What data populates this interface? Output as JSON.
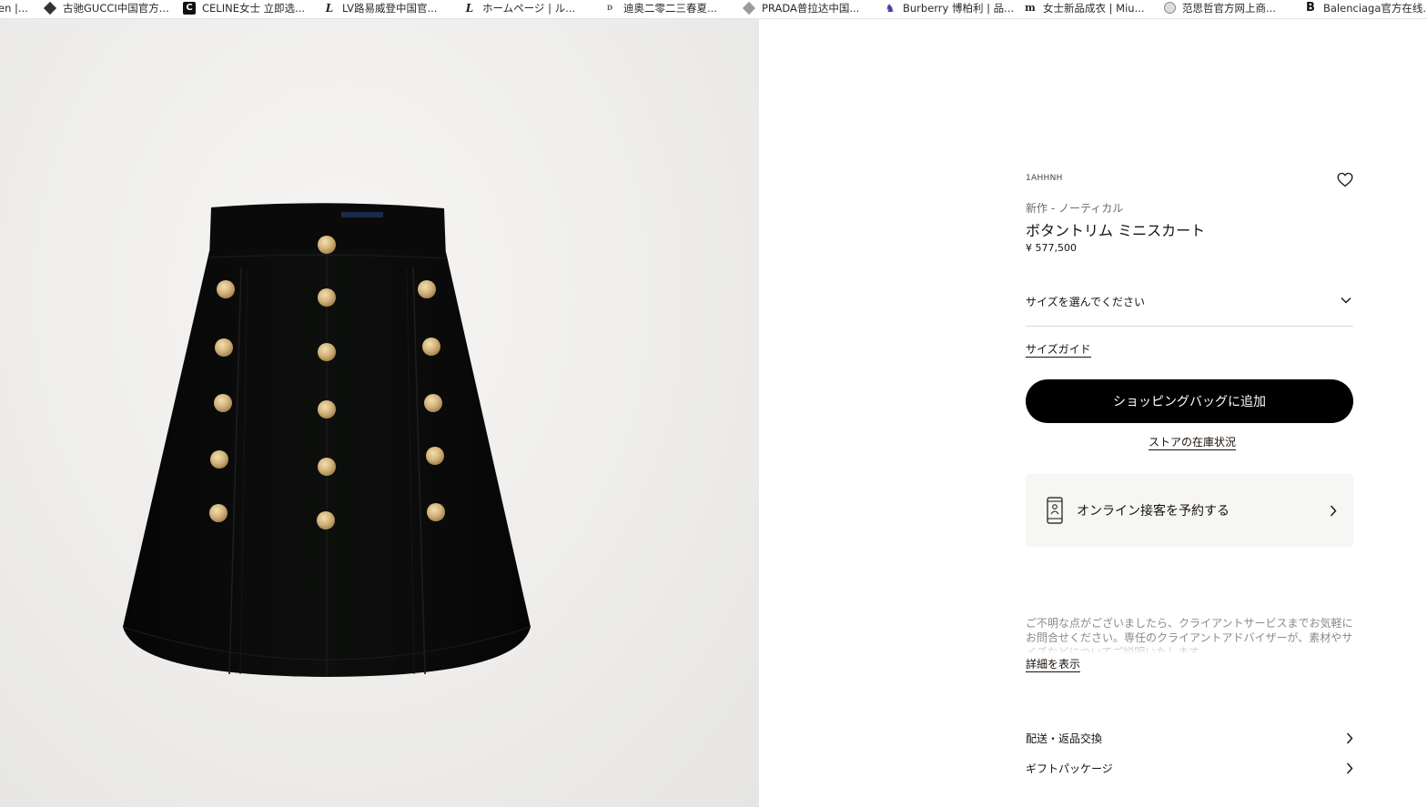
{
  "bookmarks": [
    {
      "label": "en |...",
      "icon": "page-icon"
    },
    {
      "label": "古驰GUCCI中国官方...",
      "icon": "gucci-favicon"
    },
    {
      "label": "CELINE女士 立即选...",
      "icon": "celine-favicon"
    },
    {
      "label": "LV路易威登中国官...",
      "icon": "lv-favicon"
    },
    {
      "label": "ホームページ | ル...",
      "icon": "lv-favicon"
    },
    {
      "label": "迪奥二零二三春夏...",
      "icon": "dior-favicon"
    },
    {
      "label": "PRADA普拉达中国...",
      "icon": "prada-favicon"
    },
    {
      "label": "Burberry 博柏利 | 品...",
      "icon": "burberry-favicon"
    },
    {
      "label": "女士新品成衣 | Miu...",
      "icon": "miumiu-favicon"
    },
    {
      "label": "范思哲官方网上商...",
      "icon": "versace-favicon"
    },
    {
      "label": "Balenciaga官方在线...",
      "icon": "balenciaga-favicon"
    }
  ],
  "product": {
    "sku": "1AHHNH",
    "category": "新作 - ノーティカル",
    "title": "ボタントリム ミニスカート",
    "price": "¥ 577,500"
  },
  "size_select": {
    "label": "サイズを選んでください"
  },
  "links": {
    "size_guide": "サイズガイド",
    "store_stock": "ストアの在庫状況",
    "read_more": "詳細を表示"
  },
  "add_to_bag": "ショッピングバッグに追加",
  "appointment": "オンライン接客を予約する",
  "help_text": "ご不明な点がございましたら、クライアントサービスまでお気軽にお問合せください。専任のクライアントアドバイザーが、素材やサイズなどについてご説明いたします。",
  "accordions": {
    "shipping": "配送・返品交換",
    "gift": "ギフトパッケージ"
  },
  "colors": {
    "button_bg": "#000000",
    "text": "#19110b",
    "panel_bg": "#f6f6f5"
  }
}
